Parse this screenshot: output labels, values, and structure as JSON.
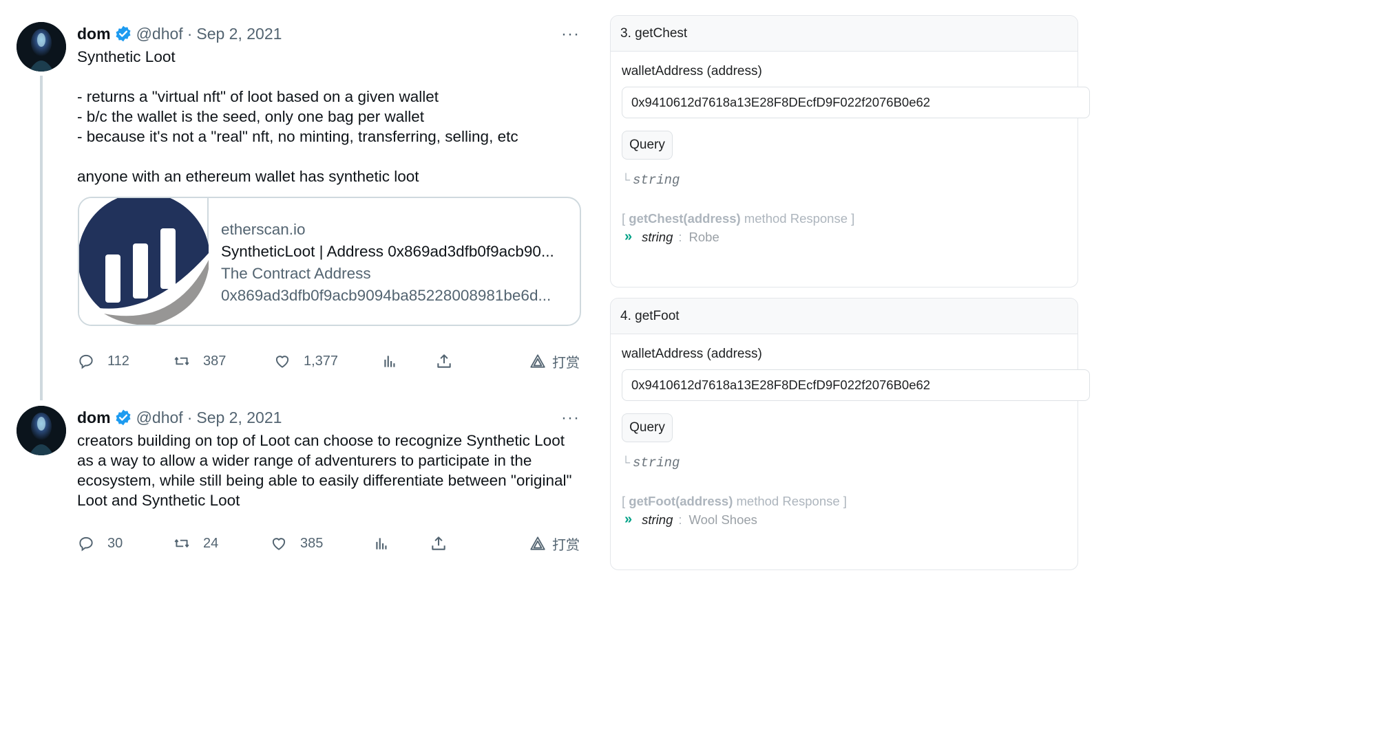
{
  "tweets": [
    {
      "name": "dom",
      "handle": "@dhof",
      "separator": "·",
      "date": "Sep 2, 2021",
      "more": "···",
      "lines": [
        "Synthetic Loot",
        "",
        "- returns a \"virtual nft\" of loot based on a given wallet",
        "- b/c the wallet is the seed, only one bag per wallet",
        "- because it's not a \"real\" nft, no minting, transferring, selling, etc",
        "",
        "anyone with an ethereum wallet has synthetic loot"
      ],
      "card": {
        "domain": "etherscan.io",
        "title": "SyntheticLoot | Address 0x869ad3dfb0f9acb90...",
        "desc1": "The Contract Address",
        "desc2": "0x869ad3dfb0f9acb9094ba85228008981be6d..."
      },
      "stats": {
        "replies": "112",
        "retweets": "387",
        "likes": "1,377",
        "tip": "打赏"
      }
    },
    {
      "name": "dom",
      "handle": "@dhof",
      "separator": "·",
      "date": "Sep 2, 2021",
      "more": "···",
      "lines": [
        "creators building on top of Loot can choose to recognize Synthetic Loot",
        "as a way to allow a wider range of adventurers to participate in the",
        "ecosystem, while still being able to easily differentiate between \"original\"",
        "Loot and Synthetic Loot"
      ],
      "stats": {
        "replies": "30",
        "retweets": "24",
        "likes": "385",
        "tip": "打赏"
      }
    }
  ],
  "panels": [
    {
      "title": "3. getChest",
      "field_label": "walletAddress (address)",
      "address": "0x9410612d7618a13E28F8DEcfD9F022f2076B0e62",
      "button": "Query",
      "return_type": "string",
      "resp_open": "[",
      "resp_method": "getChest(address)",
      "resp_suffix": "method Response ]",
      "result_type": "string",
      "result_colon": ":",
      "result_value": "Robe"
    },
    {
      "title": "4. getFoot",
      "field_label": "walletAddress (address)",
      "address": "0x9410612d7618a13E28F8DEcfD9F022f2076B0e62",
      "button": "Query",
      "return_type": "string",
      "resp_open": "[",
      "resp_method": "getFoot(address)",
      "resp_suffix": "method Response ]",
      "result_type": "string",
      "result_colon": ":",
      "result_value": "Wool Shoes"
    }
  ],
  "colors": {
    "verified": "#1d9bf0",
    "etherscan_navy": "#21325b",
    "etherscan_gray": "#979695",
    "result_chevron": "#00a186"
  }
}
